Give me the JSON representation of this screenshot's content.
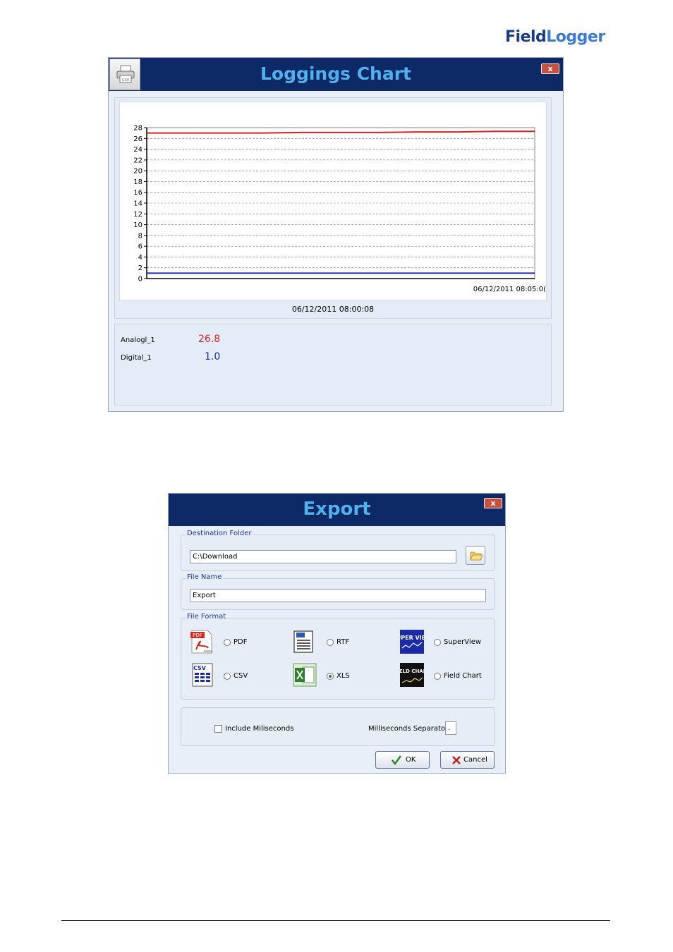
{
  "brand": {
    "part1": "Field",
    "part2": "Logger"
  },
  "loggings_chart": {
    "title": "Loggings Chart",
    "close_label": "x",
    "print_button_text": "CSV",
    "chart_data": {
      "type": "line",
      "ylim": [
        0,
        28
      ],
      "yticks": [
        "0",
        "2",
        "4",
        "6",
        "8",
        "10",
        "12",
        "14",
        "16",
        "18",
        "20",
        "22",
        "24",
        "26",
        "28"
      ],
      "x_end_label": "06/12/2011 08:05:0(",
      "grid": true,
      "series": [
        {
          "name": "Analogl_1",
          "color": "#e02020",
          "values": [
            27.0,
            27.0,
            27.0,
            27.0,
            27.1,
            27.1,
            27.1,
            27.2,
            27.2,
            27.3,
            27.3
          ]
        },
        {
          "name": "Digital_1",
          "color": "#1a2aa8",
          "values": [
            1.0,
            1.0,
            1.0,
            1.0,
            1.0,
            1.0,
            1.0,
            1.0,
            1.0,
            1.0,
            1.0
          ]
        }
      ]
    },
    "current_datetime": "06/12/2011 08:00:08",
    "channels": [
      {
        "name": "Analogl_1",
        "value": "26.8",
        "color": "#e02020"
      },
      {
        "name": "Digital_1",
        "value": "1.0",
        "color": "#1a2aa8"
      }
    ]
  },
  "export": {
    "title": "Export",
    "close_label": "x",
    "destination_folder": {
      "label": "Destination Folder",
      "value": "C:\\Download"
    },
    "file_name": {
      "label": "File Name",
      "value": "Export"
    },
    "file_format": {
      "label": "File Format",
      "options": [
        {
          "label": "PDF",
          "icon": "pdf-icon",
          "selected": false
        },
        {
          "label": "RTF",
          "icon": "rtf-icon",
          "selected": false
        },
        {
          "label": "SuperView",
          "icon": "superview-icon",
          "selected": false
        },
        {
          "label": "CSV",
          "icon": "csv-icon",
          "selected": false
        },
        {
          "label": "XLS",
          "icon": "xls-icon",
          "selected": true
        },
        {
          "label": "Field Chart",
          "icon": "field-chart-icon",
          "selected": false
        }
      ],
      "icon_texts": {
        "pdf": "PDF",
        "pdf_sub": "Adobe",
        "csv": "CSV",
        "superview": "SUPER VIEW",
        "fieldchart": "FIELD CHART"
      }
    },
    "include_milliseconds": {
      "label": "Include Miliseconds",
      "checked": false
    },
    "milliseconds_separator": {
      "label": "Milliseconds Separator",
      "value": "."
    },
    "ok_label": "OK",
    "cancel_label": "Cancel"
  }
}
